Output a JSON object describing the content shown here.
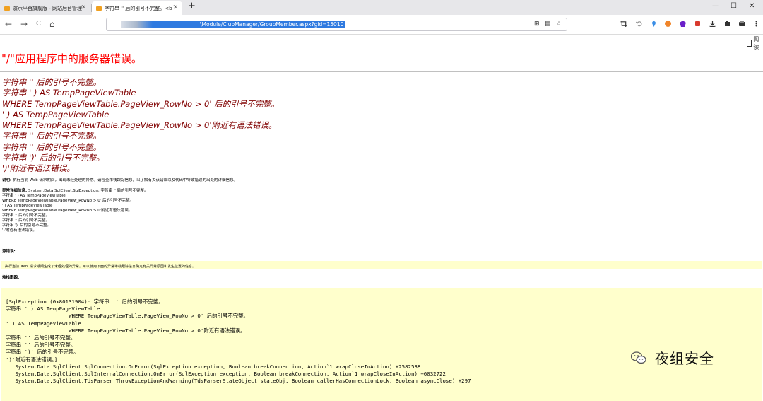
{
  "tabs": [
    {
      "label": "演示平台旗舰版 - 网站后台管理",
      "active": false
    },
    {
      "label": "字符串 '' 后的引号不完整。<b",
      "active": true
    }
  ],
  "new_tab_label": "+",
  "window_controls": {
    "minimize": "—",
    "maximize": "☐",
    "close": "✕"
  },
  "nav": {
    "back": "←",
    "forward": "→",
    "reload": "C",
    "home": "⌂"
  },
  "url": {
    "visible_text": "\\Module/ClubManager/GroupMember.aspx?gid=15010"
  },
  "reading_mode_label": "阅读",
  "page": {
    "title": "\"/\"应用程序中的服务器错误。",
    "error_lines": [
      "字符串 '' 后的引号不完整。",
      "字符串 ' ) AS TempPageViewTable",
      "WHERE TempPageViewTable.PageView_RowNo > 0' 后的引号不完整。",
      "' ) AS TempPageViewTable",
      "WHERE TempPageViewTable.PageView_RowNo > 0'附近有语法错误。",
      "字符串 '' 后的引号不完整。",
      "字符串 '' 后的引号不完整。",
      "字符串 ')' 后的引号不完整。",
      "')'附近有语法错误。"
    ],
    "description_label": "说明:",
    "description_text": "执行当前 Web 请求期间，出现未经处理的异常。请检查堆栈跟踪信息，以了解有关该错误以及代码中导致错误的出处的详细信息。",
    "exception_label": "异常详细信息:",
    "exception_text": "System.Data.SqlClient.SqlException: 字符串 '' 后的引号不完整。",
    "exception_lines": [
      "字符串 ' ) AS TempPageViewTable",
      "WHERE TempPageViewTable.PageView_RowNo > 0' 后的引号不完整。",
      "' ) AS TempPageViewTable",
      "WHERE TempPageViewTable.PageView_RowNo > 0'附近有语法错误。",
      "字符串 '' 后的引号不完整。",
      "字符串 '' 后的引号不完整。",
      "字符串 ')' 后的引号不完整。",
      "')'附近有语法错误。"
    ],
    "source_error_label": "源错误:",
    "source_error_text": "执行当前 Web 请求期间生成了未经处理的异常。可以使用下面的异常堆栈跟踪信息确定有关异常原因和发生位置的信息。",
    "stack_trace_label": "堆栈跟踪:",
    "stack_trace_lines": [
      "[SqlException (0x80131904): 字符串 '' 后的引号不完整。",
      "字符串 ' ) AS TempPageViewTable",
      "                    WHERE TempPageViewTable.PageView_RowNo > 0' 后的引号不完整。",
      "' ) AS TempPageViewTable",
      "                    WHERE TempPageViewTable.PageView_RowNo > 0'附近有语法错误。",
      "字符串 '' 后的引号不完整。",
      "字符串 '' 后的引号不完整。",
      "字符串 ')' 后的引号不完整。",
      "')'附近有语法错误。]",
      "   System.Data.SqlClient.SqlConnection.OnError(SqlException exception, Boolean breakConnection, Action`1 wrapCloseInAction) +2582538",
      "   System.Data.SqlClient.SqlInternalConnection.OnError(SqlException exception, Boolean breakConnection, Action`1 wrapCloseInAction) +6032722",
      "   System.Data.SqlClient.TdsParser.ThrowExceptionAndWarning(TdsParserStateObject stateObj, Boolean callerHasConnectionLock, Boolean asyncClose) +297"
    ]
  },
  "watermark": "夜组安全",
  "colors": {
    "title": "#ff0000",
    "error_text": "#800000",
    "code_background": "#ffffcc",
    "url_highlight": "#2f7ae0"
  }
}
